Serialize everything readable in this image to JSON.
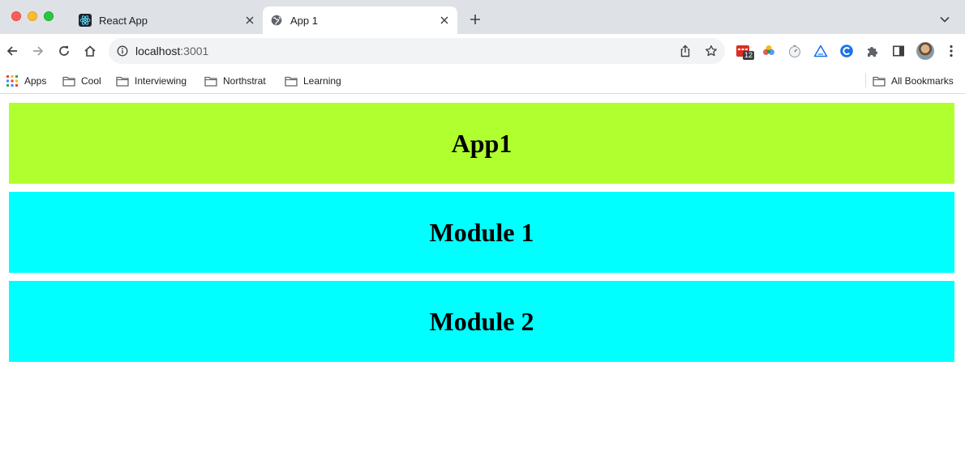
{
  "browser": {
    "tabs": [
      {
        "title": "React App",
        "active": false,
        "favicon": "react-icon"
      },
      {
        "title": "App 1",
        "active": true,
        "favicon": "globe-icon"
      }
    ],
    "address": {
      "host": "localhost",
      "port": ":3001"
    },
    "extensions": [
      {
        "name": "calendar-extension-icon",
        "badge": "12"
      },
      {
        "name": "color-wheel-extension-icon"
      },
      {
        "name": "timer-extension-icon"
      },
      {
        "name": "triangle-extension-icon"
      },
      {
        "name": "c-extension-icon"
      },
      {
        "name": "puzzle-icon"
      },
      {
        "name": "side-panel-icon"
      }
    ],
    "bookmarks": [
      {
        "label": "Apps",
        "icon": "apps-grid-icon"
      },
      {
        "label": "Cool",
        "icon": "folder-icon"
      },
      {
        "label": "Interviewing",
        "icon": "folder-icon"
      },
      {
        "label": "Northstrat",
        "icon": "folder-icon"
      },
      {
        "label": "Learning",
        "icon": "folder-icon"
      }
    ],
    "all_bookmarks": "All Bookmarks"
  },
  "page": {
    "panels": [
      {
        "heading": "App1",
        "color": "#b0ff2f"
      },
      {
        "heading": "Module 1",
        "color": "#00ffff"
      },
      {
        "heading": "Module 2",
        "color": "#00ffff"
      }
    ]
  }
}
